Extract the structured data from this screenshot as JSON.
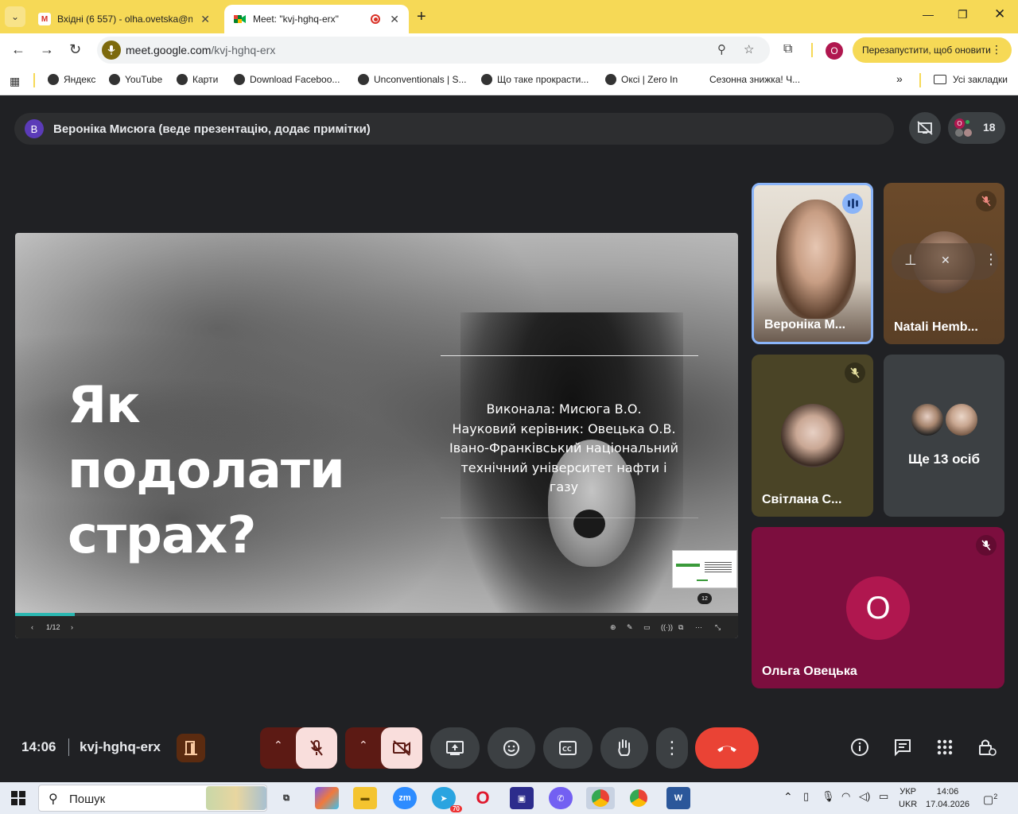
{
  "browser": {
    "tabs": [
      {
        "title": "Вхідні (6 557) - olha.ovetska@n",
        "active": false
      },
      {
        "title": "Meet: \"kvj-hghq-erx\"",
        "active": true
      }
    ],
    "url_host": "meet.google.com",
    "url_path": "/kvj-hghq-erx",
    "profile_initial": "O",
    "update_button": "Перезапустити, щоб оновити"
  },
  "bookmarks": {
    "items": [
      "Яндекс",
      "YouTube",
      "Карти",
      "Download Faceboo...",
      "Unconventionals | S...",
      "Що таке прокрасти...",
      "Оксі | Zero In",
      "Сезонна знижка! Ч..."
    ],
    "all_bookmarks": "Усі закладки"
  },
  "meet": {
    "presenter_initial": "В",
    "presenter_text": "Вероніка Мисюга (веде презентацію, додає примітки)",
    "participants_count": "18",
    "slide": {
      "title": "Як подолати страх?",
      "author": "Виконала: Мисюга В.О.",
      "supervisor": "Науковий керівник: Овецька О.В.",
      "university": "Івано-Франківський національний технічний університет нафти і газу",
      "page_badge": "12",
      "page_indicator": "1/12",
      "progress": 0.083
    },
    "tiles": [
      {
        "name": "Вероніка М...",
        "speaking": true
      },
      {
        "name": "Natali Hemb...",
        "muted": true
      },
      {
        "name": "Світлана С...",
        "muted": true
      },
      {
        "name": "Ще 13 осіб"
      },
      {
        "name": "Ольга Овецька",
        "initial": "О",
        "muted": true
      }
    ],
    "colors": {
      "background": "#202124",
      "accent_pink": "#b0174f",
      "hangup": "#ea4335"
    }
  },
  "bottom_bar": {
    "time": "14:06",
    "meeting_code": "kvj-hghq-erx"
  },
  "taskbar": {
    "search_placeholder": "Пошук",
    "lang_top": "УКР",
    "lang_bottom": "UKR",
    "clock_time": "14:06",
    "clock_date": "17.04.2026",
    "telegram_badge": "70",
    "notif_count": "2"
  }
}
